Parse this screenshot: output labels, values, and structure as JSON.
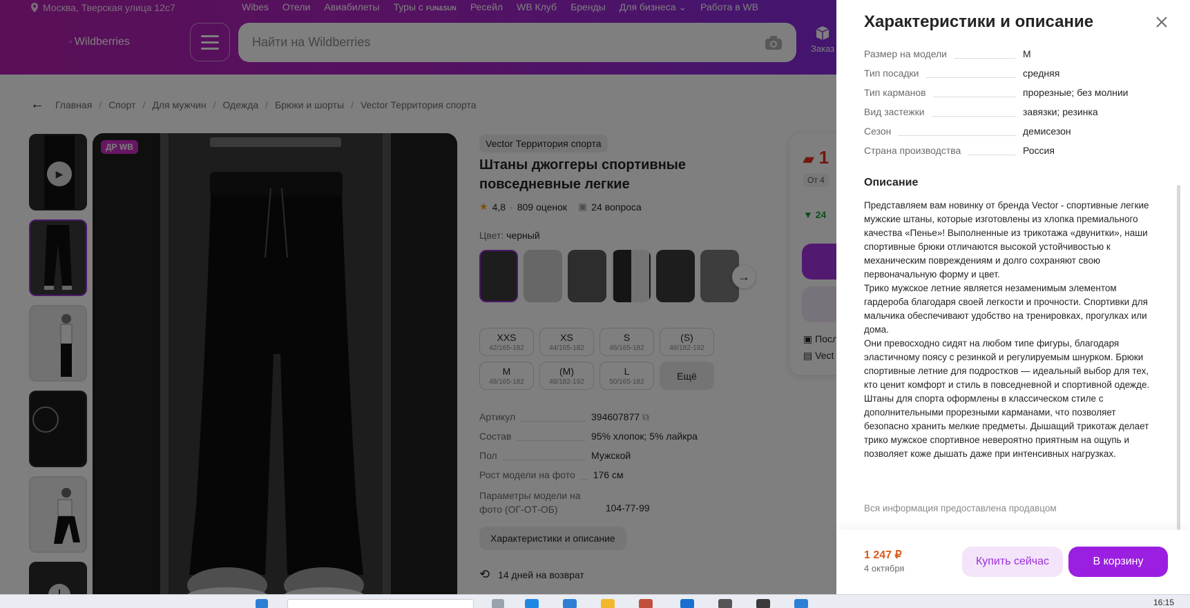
{
  "header": {
    "location": "Москва, Тверская улица 12с7",
    "nav": [
      "Wibes",
      "Отели",
      "Авиабилеты",
      "Туры с",
      "Ресейл",
      "WB Клуб",
      "Бренды",
      "Для бизнеса",
      "Работа в WB"
    ],
    "logo_alt": "Wildberries",
    "search_placeholder": "Найти на Wildberries",
    "orders_label": "Заказ"
  },
  "breadcrumb": [
    "Главная",
    "Спорт",
    "Для мужчин",
    "Одежда",
    "Брюки и шорты",
    "Vector Территория спорта"
  ],
  "gallery": {
    "badge": "ДР WB"
  },
  "product": {
    "brand": "Vector Территория спорта",
    "title": "Штаны джоггеры спортивные повседневные легкие",
    "rating": "4,8",
    "reviews": "809 оценок",
    "questions": "24 вопроса",
    "color_label": "Цвет:",
    "color_value": "черный",
    "sizes": [
      {
        "size": "XXS",
        "height": "42/165-182"
      },
      {
        "size": "XS",
        "height": "44/165-182"
      },
      {
        "size": "S",
        "height": "46/165-182"
      },
      {
        "size": "(S)",
        "height": "46/182-192"
      },
      {
        "size": "M",
        "height": "48/165-182"
      },
      {
        "size": "(M)",
        "height": "48/182-192"
      },
      {
        "size": "L",
        "height": "50/165-182"
      }
    ],
    "sizes_more": "Ещё",
    "specs": [
      {
        "k": "Артикул",
        "v": "394607877"
      },
      {
        "k": "Состав",
        "v": "95% хлопок; 5% лайкра"
      },
      {
        "k": "Пол",
        "v": "Мужской"
      },
      {
        "k": "Рост модели на фото",
        "v": "176 см"
      },
      {
        "k": "Параметры модели на фото (ОГ-ОТ-ОБ)",
        "v": "104-77-99"
      }
    ],
    "desc_button": "Характеристики и описание",
    "returns": "14 дней на возврат"
  },
  "pricecard": {
    "price_partial": "1",
    "from_partial": "От 4",
    "green_partial": "24",
    "line1": "Посл",
    "line2": "Vect"
  },
  "panel": {
    "title": "Характеристики и описание",
    "specs": [
      {
        "k": "Размер на модели",
        "v": "M"
      },
      {
        "k": "Тип посадки",
        "v": "средняя"
      },
      {
        "k": "Тип карманов",
        "v": "прорезные; без молнии"
      },
      {
        "k": "Вид застежки",
        "v": "завязки; резинка"
      },
      {
        "k": "Сезон",
        "v": "демисезон"
      },
      {
        "k": "Страна производства",
        "v": "Россия"
      }
    ],
    "description_heading": "Описание",
    "description": [
      "Представляем вам новинку от бренда Vector - спортивные легкие мужские штаны, которые изготовлены из хлопка премиального качества «Пенье»! Выполненные из трикотажа «двунитки», наши спортивные брюки отличаются высокой устойчивостью к механическим повреждениям и долго сохраняют свою первоначальную форму и цвет.",
      "Трико мужское летние является незаменимым элементом гардероба благодаря своей легкости и прочности. Спортивки для мальчика обеспечивают удобство на тренировках, прогулках или дома.",
      "Они превосходно сидят на любом типе фигуры, благодаря эластичному поясу с резинкой и регулируемым шнурком. Брюки спортивные летние для подростков — идеальный выбор для тех, кто ценит комфорт и стиль в повседневной и спортивной одежде.",
      "Штаны для спорта оформлены в классическом стиле с дополнительными прорезными карманами, что позволяет безопасно хранить мелкие предметы. Дышащий трикотаж делает трико мужское спортивное невероятно приятным на ощупь и позволяет коже дышать даже при интенсивных нагрузках."
    ],
    "seller_note": "Вся информация предоставлена продавцом",
    "footer_price": "1 247 ₽",
    "footer_date": "4 октября",
    "buy_now": "Купить сейчас",
    "to_cart": "В корзину"
  },
  "taskbar": {
    "time": "16:15"
  },
  "colors": {
    "brand_gradient_start": "#b51fb0",
    "brand_gradient_end": "#7a2ee6",
    "cart_button": "#9b1fe0",
    "price": "#d8581a"
  }
}
